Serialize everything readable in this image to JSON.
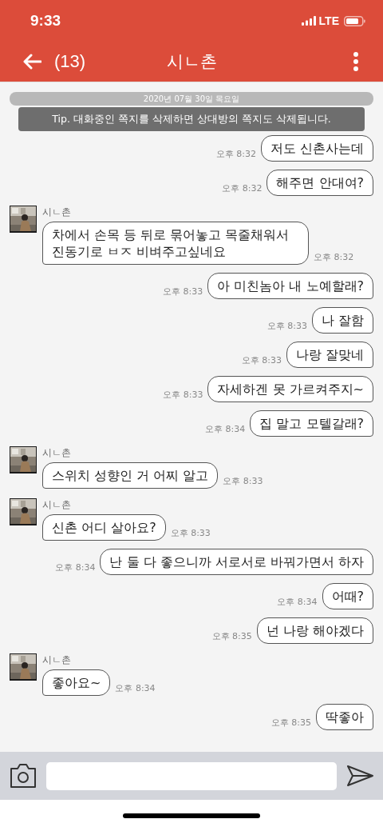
{
  "status_bar": {
    "time": "9:33",
    "network": "LTE"
  },
  "header": {
    "count": "(13)",
    "title": "시ㄴ촌"
  },
  "date_divider": "2020년 07월 30일 목요일",
  "tip": "Tip. 대화중인 쪽지를 삭제하면 상대방의 쪽지도 삭제됩니다.",
  "messages": [
    {
      "kind": "outgoing",
      "text": "저도 신촌사는데",
      "time": "오후 8:32"
    },
    {
      "kind": "outgoing",
      "text": "해주면 안대여?",
      "time": "오후 8:32"
    },
    {
      "kind": "incoming",
      "sender": "시ㄴ촌",
      "text": "차에서 손목 등 뒤로 묶어놓고 목줄채워서 진동기로 ㅂㅈ 비벼주고싶네요",
      "time": "오후 8:32"
    },
    {
      "kind": "outgoing",
      "text": "아 미친놈아 내 노예할래?",
      "time": "오후 8:33"
    },
    {
      "kind": "outgoing",
      "text": "나 잘함",
      "time": "오후 8:33"
    },
    {
      "kind": "outgoing",
      "text": "나랑 잘맞네",
      "time": "오후 8:33"
    },
    {
      "kind": "outgoing",
      "text": "자세하겐 못 가르켜주지~",
      "time": "오후 8:33"
    },
    {
      "kind": "outgoing",
      "text": "집 말고 모텔갈래?",
      "time": "오후 8:34"
    },
    {
      "kind": "incoming",
      "sender": "시ㄴ촌",
      "text": "스위치 성향인 거 어찌 알고",
      "time": "오후 8:33"
    },
    {
      "kind": "incoming",
      "sender": "시ㄴ촌",
      "text": "신촌 어디 살아요?",
      "time": "오후 8:33"
    },
    {
      "kind": "outgoing",
      "text": "난 둘 다 좋으니까 서로서로 바꿔가면서 하자",
      "time": "오후 8:34"
    },
    {
      "kind": "outgoing",
      "text": "어때?",
      "time": "오후 8:34"
    },
    {
      "kind": "outgoing",
      "text": "넌 나랑 해야겠다",
      "time": "오후 8:35"
    },
    {
      "kind": "incoming",
      "sender": "시ㄴ촌",
      "text": "좋아요~",
      "time": "오후 8:34"
    },
    {
      "kind": "outgoing",
      "text": "딱좋아",
      "time": "오후 8:35"
    }
  ]
}
